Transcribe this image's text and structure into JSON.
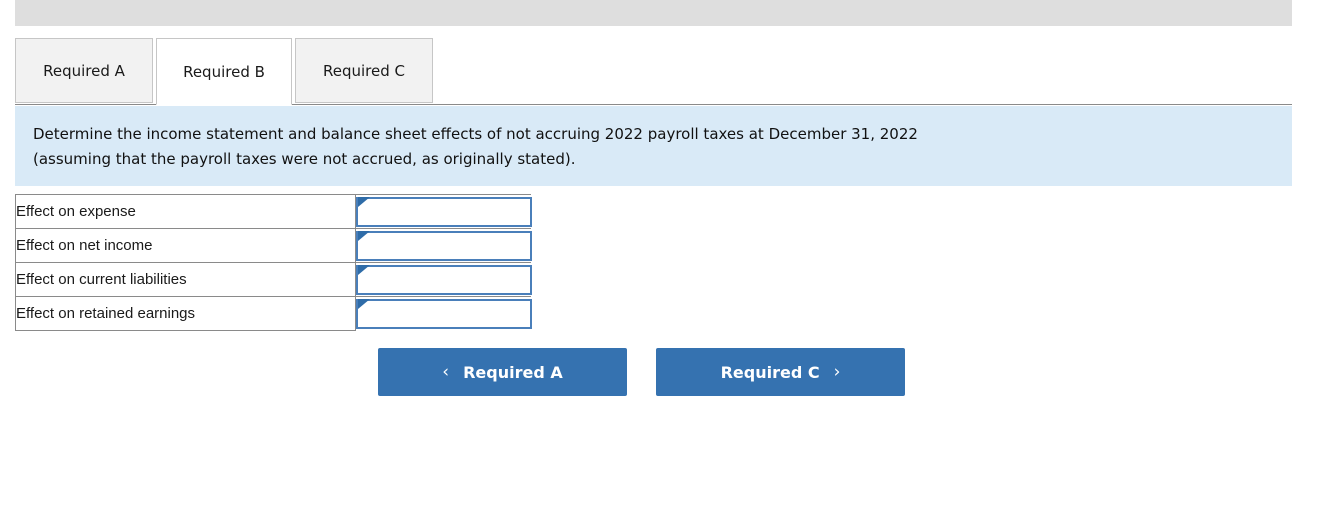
{
  "top_bar": {
    "label": "toolbar-strip"
  },
  "tabs": [
    {
      "label": "Required A",
      "active": false
    },
    {
      "label": "Required B",
      "active": true
    },
    {
      "label": "Required C",
      "active": false
    }
  ],
  "banner": {
    "line1": "Determine the income statement and balance sheet effects of not accruing 2022 payroll taxes at December 31, 2022",
    "line2": "(assuming that the payroll taxes were not accrued, as originally stated)."
  },
  "answer_table": {
    "rows": [
      {
        "label": "Effect on expense",
        "value": ""
      },
      {
        "label": "Effect on net income",
        "value": ""
      },
      {
        "label": "Effect on current liabilities",
        "value": ""
      },
      {
        "label": "Effect on retained earnings",
        "value": ""
      }
    ]
  },
  "navigation": {
    "prev": {
      "label": "Required A",
      "icon": "chevron-left-icon",
      "glyph": "‹"
    },
    "next": {
      "label": "Required C",
      "icon": "chevron-right-icon",
      "glyph": "›"
    }
  },
  "colors": {
    "accent_blue": "#3572b0",
    "banner_blue": "#d9eaf7",
    "input_border": "#4a7fba",
    "top_bar_gray": "#dedede",
    "tab_inactive": "#f2f2f2"
  }
}
